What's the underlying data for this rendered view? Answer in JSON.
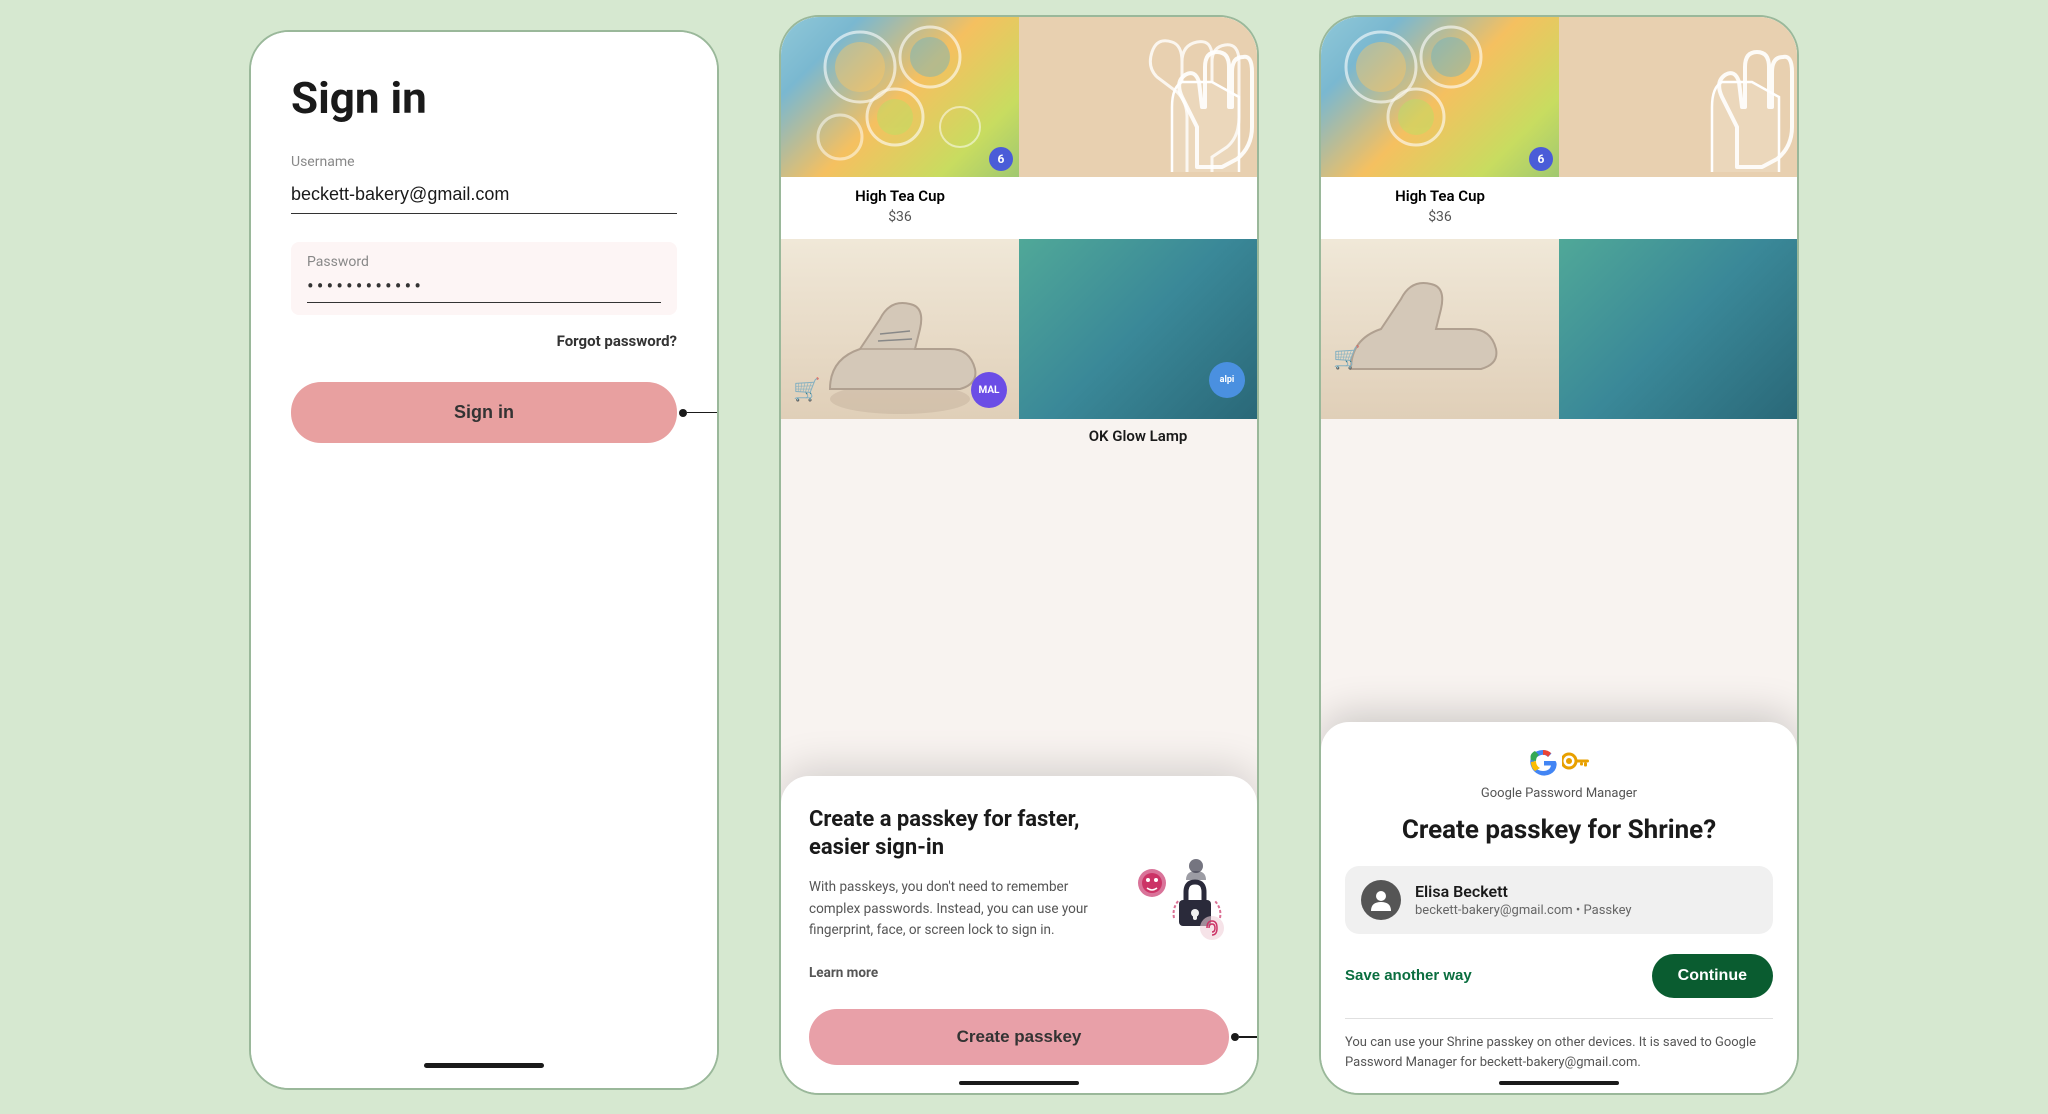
{
  "page": {
    "title": "Sign in",
    "background": "#d6e8d0"
  },
  "screen1": {
    "title": "Sign in",
    "username_label": "Username",
    "username_value": "beckett-bakery@gmail.com",
    "password_label": "Password",
    "password_value": "••••••••••••",
    "forgot_password": "Forgot password?",
    "signin_button": "Sign in"
  },
  "screen2": {
    "products": [
      {
        "name": "High Tea Cup",
        "price": "$36"
      },
      {
        "name": "",
        "price": ""
      },
      {
        "name": "",
        "price": ""
      },
      {
        "name": "OK Glow Lamp",
        "price": ""
      }
    ],
    "passkey_sheet": {
      "title": "Create a passkey for faster, easier sign-in",
      "description": "With passkeys, you don't need to remember complex passwords. Instead, you can use your fingerprint, face, or screen lock to sign in.",
      "learn_more": "Learn more",
      "button": "Create passkey"
    }
  },
  "screen3": {
    "products": [
      {
        "name": "High Tea Cup",
        "price": "$36"
      }
    ],
    "dialog": {
      "provider": "Google Password Manager",
      "title": "Create passkey for Shrine?",
      "user_name": "Elisa Beckett",
      "user_detail": "beckett-bakery@gmail.com • Passkey",
      "save_another": "Save another way",
      "continue": "Continue",
      "footnote": "You can use your Shrine passkey on other devices. It is saved to Google Password Manager for beckett-bakery@gmail.com."
    }
  },
  "arrows": {
    "arrow1_dot": "•",
    "arrow2_dot": "•"
  },
  "icons": {
    "cart": "🛒",
    "user": "👤",
    "key": "🔑"
  }
}
